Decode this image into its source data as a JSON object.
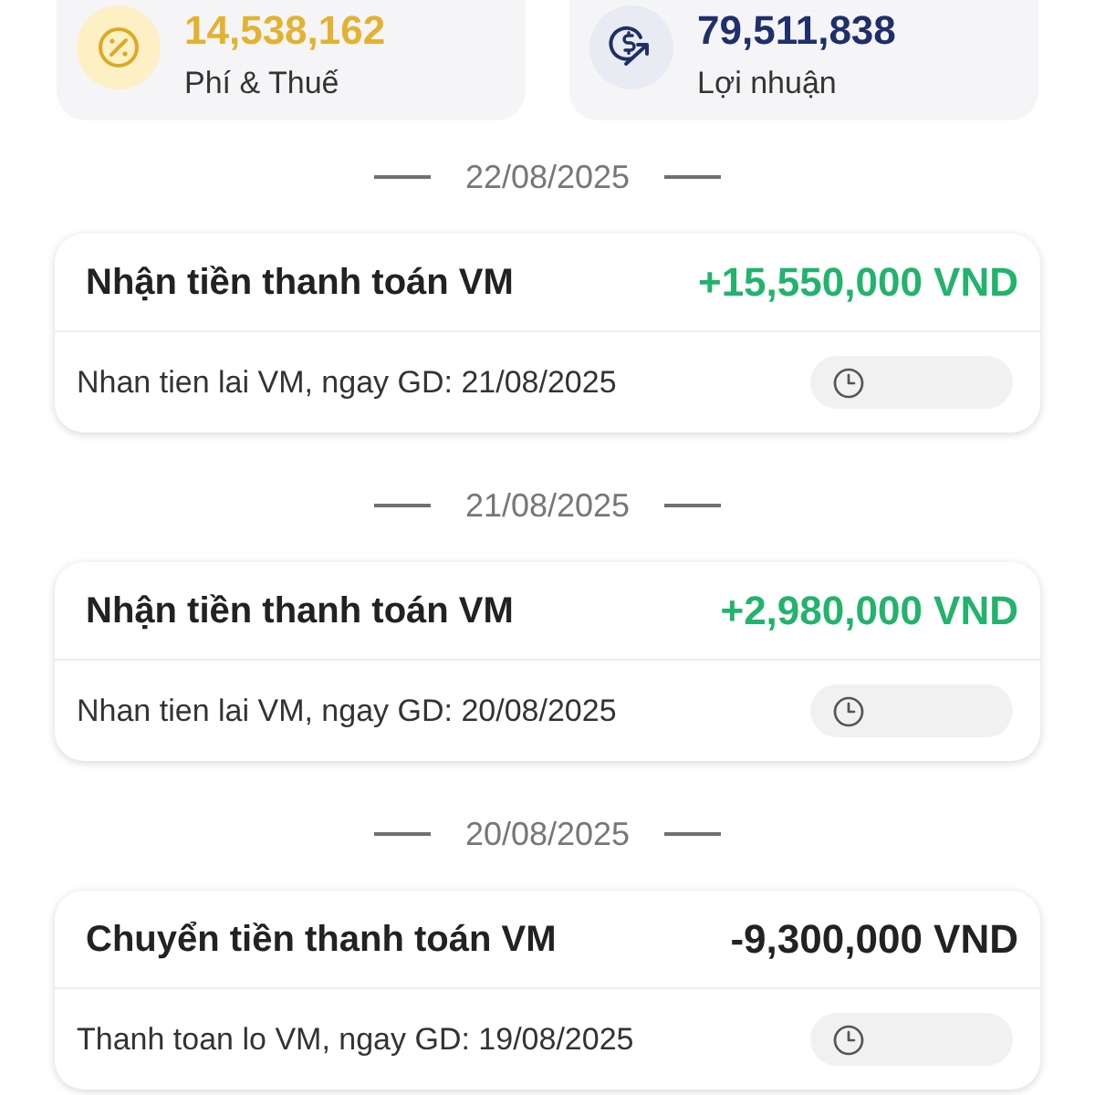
{
  "stats": [
    {
      "kind": "fee",
      "value": "14,538,162",
      "label": "Phí & Thuế"
    },
    {
      "kind": "profit",
      "value": "79,511,838",
      "label": "Lợi nhuận"
    }
  ],
  "days": [
    {
      "date": "22/08/2025",
      "transactions": [
        {
          "title": "Nhận tiền thanh toán VM",
          "amount": "+15,550,000 VND",
          "kind": "credit",
          "description": "Nhan tien lai VM, ngay GD: 21/08/2025"
        }
      ]
    },
    {
      "date": "21/08/2025",
      "transactions": [
        {
          "title": "Nhận tiền thanh toán VM",
          "amount": "+2,980,000 VND",
          "kind": "credit",
          "description": "Nhan tien lai VM, ngay GD: 20/08/2025"
        }
      ]
    },
    {
      "date": "20/08/2025",
      "transactions": [
        {
          "title": "Chuyển tiền thanh toán VM",
          "amount": "-9,300,000 VND",
          "kind": "debit",
          "description": "Thanh toan lo VM, ngay GD: 19/08/2025"
        }
      ]
    }
  ]
}
